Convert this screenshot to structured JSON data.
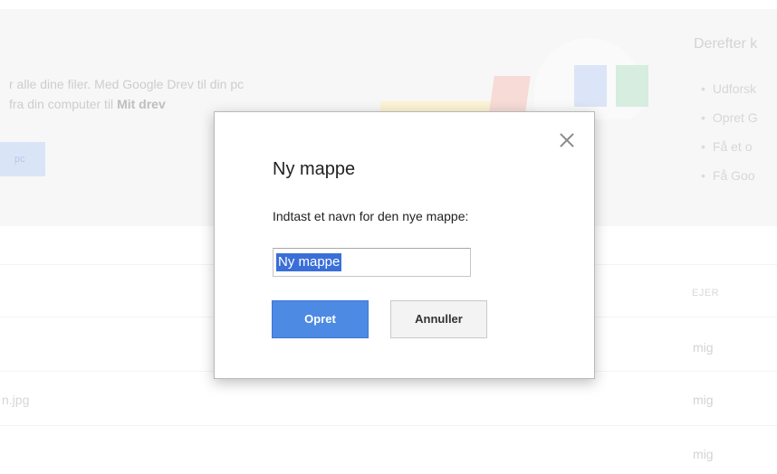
{
  "background": {
    "promo_line1": "r alle dine filer. Med Google Drev til din pc",
    "promo_line2_prefix": "fra din computer til ",
    "promo_line2_bold": "Mit drev",
    "pc_button_label": "pc",
    "then_title": "Derefter k",
    "then_items": [
      "Udforsk",
      "Opret G",
      "Få et o",
      "Få Goo"
    ],
    "owner_header": "EJER",
    "file_name": "n.jpg",
    "owners": [
      "mig",
      "mig",
      "mig"
    ]
  },
  "dialog": {
    "title": "Ny mappe",
    "prompt": "Indtast et navn for den nye mappe:",
    "input_value": "Ny mappe",
    "create_label": "Opret",
    "cancel_label": "Annuller",
    "close_icon": "close-icon"
  },
  "colors": {
    "primary_button": "#4d8ae3",
    "selection": "#3a6fd8",
    "cancel_button": "#f3f3f3"
  }
}
